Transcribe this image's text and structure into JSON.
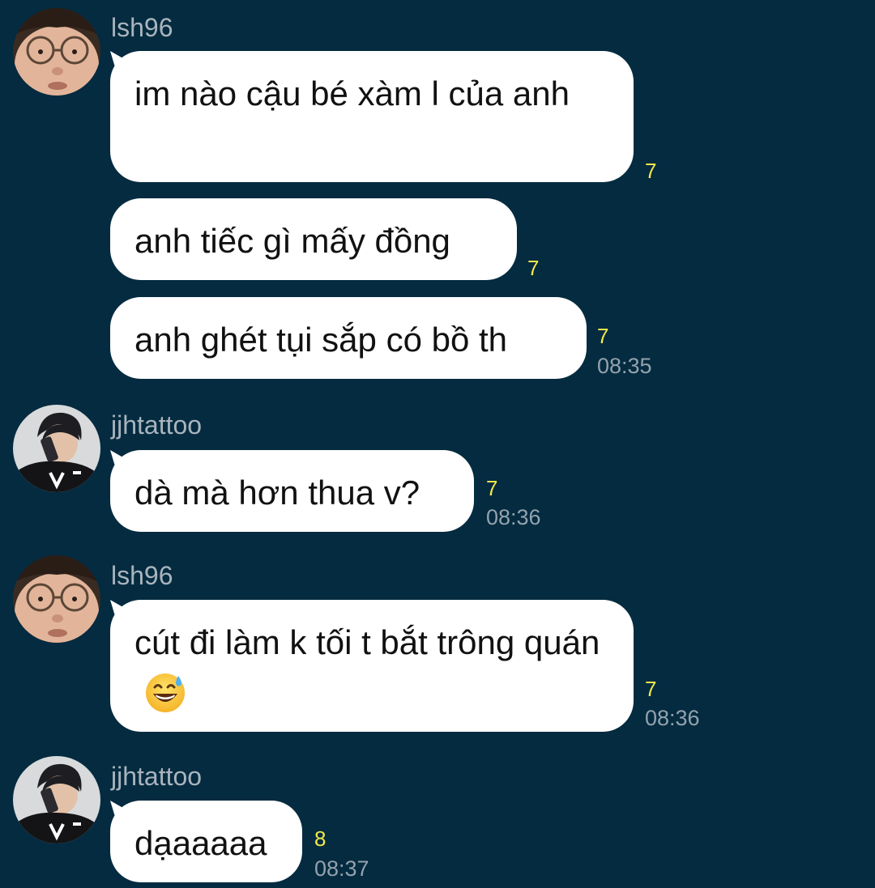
{
  "messages": [
    {
      "sender": "lsh96",
      "avatar_icon": "user-photo-glasses",
      "bubbles": [
        {
          "text": "im nào cậu bé xàm l của anh",
          "unread": "7",
          "time": ""
        },
        {
          "text": "anh tiếc gì mấy đồng",
          "unread": "7",
          "time": ""
        },
        {
          "text": "anh ghét tụi sắp có bồ th",
          "unread": "7",
          "time": "08:35"
        }
      ]
    },
    {
      "sender": "jjhtattoo",
      "avatar_icon": "user-photo-phone",
      "bubbles": [
        {
          "text": "dà mà hơn thua v?",
          "unread": "7",
          "time": "08:36"
        }
      ]
    },
    {
      "sender": "lsh96",
      "avatar_icon": "user-photo-glasses",
      "bubbles": [
        {
          "text": "cút đi làm k tối t bắt trông quán",
          "emoji": "grinning-sweat-emoji",
          "unread": "7",
          "time": "08:36"
        }
      ]
    },
    {
      "sender": "jjhtattoo",
      "avatar_icon": "user-photo-phone",
      "bubbles": [
        {
          "text": "dạaaaaa",
          "unread": "8",
          "time": "08:37"
        }
      ]
    }
  ],
  "colors": {
    "background": "#042b40",
    "bubble": "#ffffff",
    "unread": "#f2e94a",
    "meta": "#93a2ad"
  }
}
